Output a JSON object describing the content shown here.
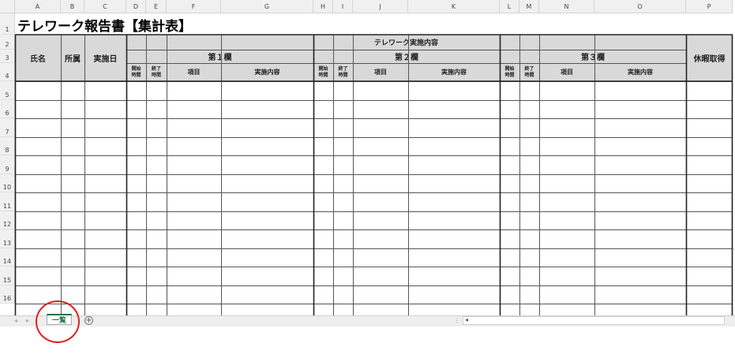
{
  "sheet_title": "テレワーク報告書【集計表】",
  "column_letters": [
    "A",
    "B",
    "C",
    "D",
    "E",
    "F",
    "G",
    "H",
    "I",
    "J",
    "K",
    "L",
    "M",
    "N",
    "O",
    "P"
  ],
  "row_numbers": [
    "1",
    "2",
    "3",
    "4",
    "5",
    "6",
    "7",
    "8",
    "9",
    "10",
    "11",
    "12",
    "13",
    "14",
    "15",
    "16"
  ],
  "headers": {
    "name": "氏名",
    "affiliation": "所属",
    "date": "実施日",
    "content_group": "テレワーク実施内容",
    "leave": "休暇取得",
    "sections": [
      "第１欄",
      "第２欄",
      "第３欄"
    ],
    "start_time": "開始\n時間",
    "end_time": "終了\n時間",
    "item": "項目",
    "details": "実施内容"
  },
  "sheet_tabs": [
    {
      "label": "一覧",
      "active": true
    }
  ],
  "colors": {
    "accent": "#217346",
    "header_fill": "#d9d9d9",
    "highlight_circle": "#e02020"
  }
}
